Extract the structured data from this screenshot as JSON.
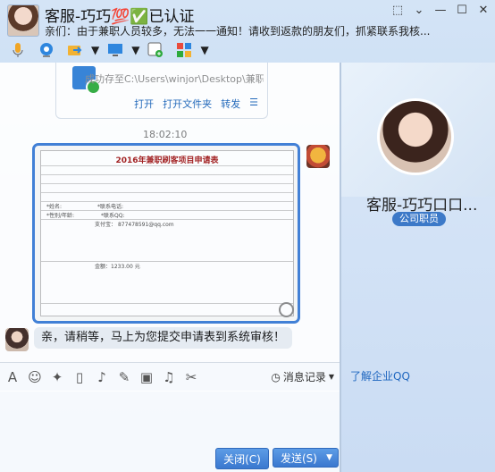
{
  "header": {
    "title": "客服-巧巧💯✅已认证",
    "subtitle": "亲们：由于兼职人员较多，无法一一通知！请收到返款的朋友们，抓紧联系我核...",
    "window_buttons": [
      "⬚",
      "⌄",
      "—",
      "☐",
      "✕"
    ]
  },
  "toolbar": {
    "icons": [
      "microphone-icon",
      "video-icon",
      "file-transfer-icon",
      "screen-share-icon",
      "add-contact-icon",
      "apps-icon"
    ]
  },
  "chat": {
    "file_card": {
      "save_text": "成功存至C:\\Users\\winjor\\Desktop\\兼职申请...",
      "actions": [
        "打开",
        "打开文件夹",
        "转发"
      ]
    },
    "timestamp": "18:02:10",
    "form_image": {
      "title": "2016年兼职刷客项目申请表",
      "field_name_label": "*姓名:",
      "field_age_label": "*性别/年龄:",
      "field_phone_label": "*联系电话:",
      "field_qq_label": "*联系QQ:",
      "alipay_label": "支付宝：",
      "alipay_value": "877478591@qq.com",
      "amount_label": "金额：1233.00 元"
    },
    "reply": "亲，请稍等，马上为您提交申请表到系统审核！"
  },
  "format_bar": {
    "history_label": "消息记录"
  },
  "input": {
    "close_label": "关闭(C)",
    "send_label": "发送(S)"
  },
  "profile": {
    "name": "客服-巧巧口口...",
    "badge": "公司职员",
    "link": "了解企业QQ"
  }
}
